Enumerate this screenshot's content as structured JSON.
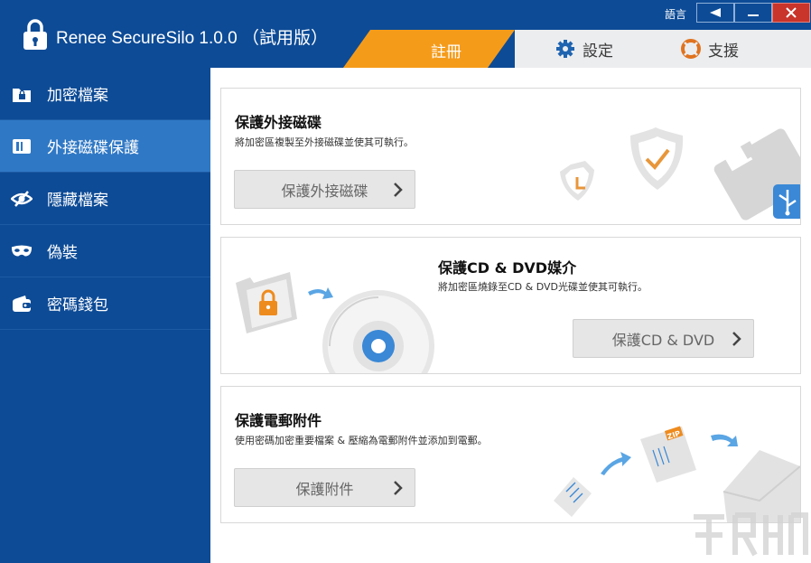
{
  "app": {
    "title": "Renee SecureSilo 1.0.0 （試用版）",
    "language_label": "語言"
  },
  "tabs": {
    "register": "註冊",
    "settings": "設定",
    "support": "支援"
  },
  "sidebar": {
    "items": [
      {
        "label": "加密檔案",
        "icon": "folder-lock-icon"
      },
      {
        "label": "外接磁碟保護",
        "icon": "external-drive-icon"
      },
      {
        "label": "隱藏檔案",
        "icon": "eye-slash-icon"
      },
      {
        "label": "偽裝",
        "icon": "mask-icon"
      },
      {
        "label": "密碼錢包",
        "icon": "wallet-icon"
      }
    ],
    "active_index": 1
  },
  "cards": [
    {
      "title": "保護外接磁碟",
      "desc": "將加密區複製至外接磁碟並使其可執行。",
      "button": "保護外接磁碟"
    },
    {
      "title": "保護CD & DVD媒介",
      "desc": "將加密區燒錄至CD & DVD光碟並使其可執行。",
      "button": "保護CD & DVD"
    },
    {
      "title": "保護電郵附件",
      "desc": "使用密碼加密重要檔案 & 壓縮為電郵附件並添加到電郵。",
      "button": "保護附件"
    }
  ],
  "illustrations": {
    "zip_label": "ZIP"
  },
  "colors": {
    "primary": "#0d4b96",
    "active": "#2f78c5",
    "accent": "#f59b1a",
    "close": "#c9342b"
  }
}
